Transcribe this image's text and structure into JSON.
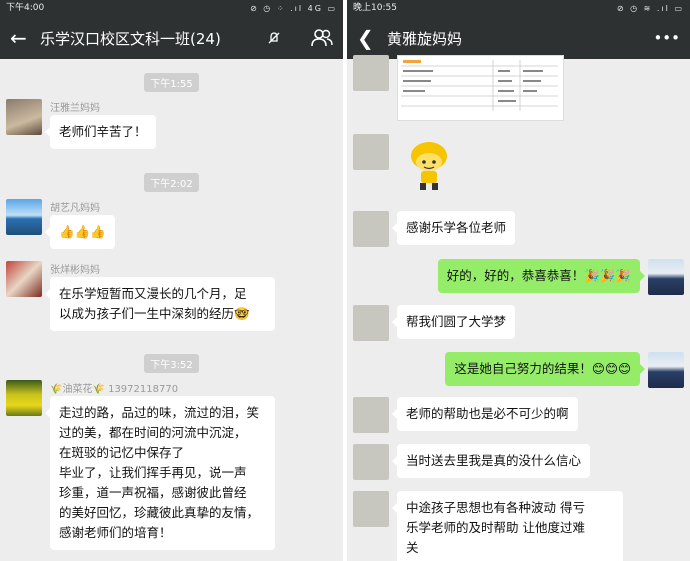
{
  "left": {
    "status": {
      "time": "下午4:00",
      "icons": "⊘ ◷ ⁘ .ıl 4G ▭"
    },
    "title": "乐学汉口校区文科一班(24)",
    "times": [
      "下午1:55",
      "下午2:02",
      "下午3:52"
    ],
    "messages": [
      {
        "sender": "汪雅兰妈妈",
        "text": "老师们辛苦了！"
      },
      {
        "sender": "胡艺凡妈妈",
        "text": "👍👍👍"
      },
      {
        "sender": "张烊彬妈妈",
        "line1": "在乐学短暂而又漫长的几个月，足",
        "line2": "以成为孩子们一生中深刻的经历🤓"
      },
      {
        "sender": "🌾油菜花🌾 13972118770",
        "lines": [
          "走过的路，品过的味，流过的泪，笑",
          "过的美，都在时间的河流中沉淀，",
          "在斑驳的记忆中保存了",
          "毕业了，让我们挥手再见，说一声",
          "珍重，道一声祝福，感谢彼此曾经",
          "的美好回忆，珍藏彼此真挚的友情，",
          "感谢老师们的培育！"
        ]
      }
    ]
  },
  "right": {
    "status": {
      "time": "晚上10:55",
      "icons": "⊘ ◷ ≋ .ıl ▭"
    },
    "title": "黄雅旋妈妈",
    "messages": [
      {
        "from": "them",
        "text": "感谢乐学各位老师"
      },
      {
        "from": "me",
        "text": "好的，好的，恭喜恭喜！🎉🎉🎉"
      },
      {
        "from": "them",
        "text": "帮我们圆了大学梦"
      },
      {
        "from": "me",
        "text": "这是她自己努力的结果！😊😊😊"
      },
      {
        "from": "them",
        "text": "老师的帮助也是必不可少的啊"
      },
      {
        "from": "them",
        "text": "当时送去里我是真的没什么信心"
      },
      {
        "from": "them",
        "lines": [
          "中途孩子思想也有各种波动  得亏",
          "乐学老师的及时帮助  让他度过难",
          "关"
        ]
      }
    ]
  },
  "colors": {
    "bar": "#2e3132",
    "chat_bg": "#ededed",
    "my_bubble": "#95ec69"
  }
}
